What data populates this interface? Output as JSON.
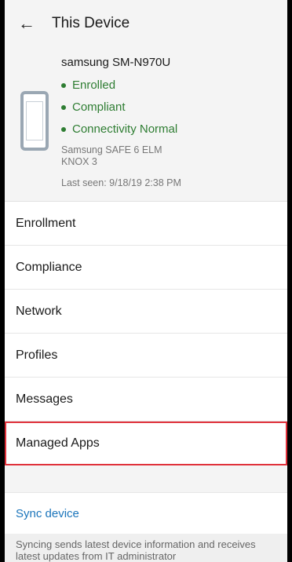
{
  "header": {
    "title": "This Device",
    "back_icon": "arrow-left-icon"
  },
  "device": {
    "name": "samsung SM-N970U",
    "statuses": [
      "Enrolled",
      "Compliant",
      "Connectivity Normal"
    ],
    "os_line1": "Samsung SAFE 6 ELM",
    "os_line2": "KNOX 3",
    "last_seen": "Last seen: 9/18/19 2:38 PM",
    "status_color": "#2e7d32"
  },
  "menu": {
    "items": [
      "Enrollment",
      "Compliance",
      "Network",
      "Profiles",
      "Messages",
      "Managed Apps"
    ],
    "highlight_color": "#e0313b"
  },
  "sync": {
    "label": "Sync device",
    "description": "Syncing sends latest device information and receives latest updates from IT administrator",
    "link_color": "#1b75bb"
  }
}
